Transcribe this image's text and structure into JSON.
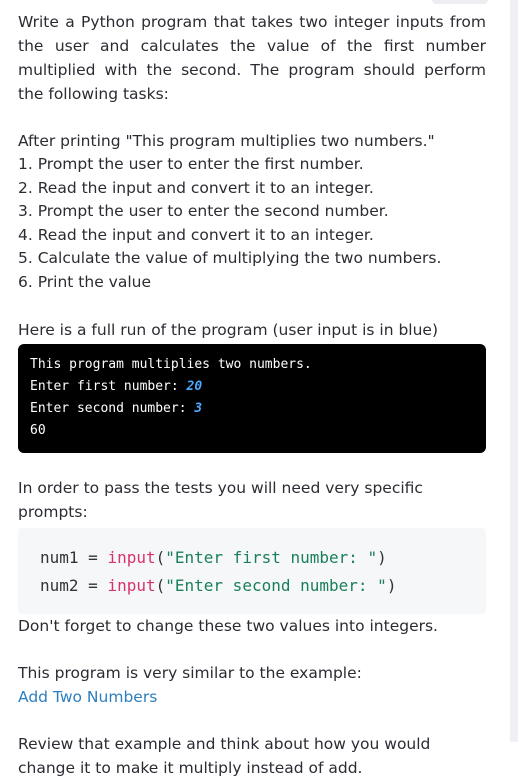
{
  "intro": "Write a Python program that takes two integer inputs from the user and calculates the value of the first number multiplied with the second. The program should perform the following tasks:",
  "after_printing": "After printing \"This program multiplies two numbers.\"",
  "steps": [
    "1. Prompt the user to enter the first number.",
    "2. Read the input and convert it to an integer.",
    "3. Prompt the user to enter the second number.",
    "4. Read the input and convert it to an integer.",
    "5. Calculate the value of multiplying the two numbers.",
    "6. Print the value"
  ],
  "full_run_text": "Here is a full run of the program (user input is in blue)",
  "terminal": {
    "line1": "This program multiplies two numbers.",
    "line2_prompt": "Enter first number: ",
    "line2_input": "20",
    "line3_prompt": "Enter second number: ",
    "line3_input": "3",
    "line4": "60"
  },
  "tests_text": "In order to pass the tests you will need very specific prompts:",
  "code": {
    "line1_var": "num1 = ",
    "line1_func": "input",
    "line1_open": "(",
    "line1_str": "\"Enter first number: \"",
    "line1_close": ")",
    "line2_var": "num2 = ",
    "line2_func": "input",
    "line2_open": "(",
    "line2_str": "\"Enter second number: \"",
    "line2_close": ")"
  },
  "forget_text": "Don't forget to change these two values into integers.",
  "similar_text": "This program is very similar to the example:",
  "example_link": "Add Two Numbers",
  "review_text": "Review that example and think about how you would change it to make it multiply instead of add.",
  "colors": {
    "user_input": "#4aa8ff",
    "keyword": "#d6336c",
    "string": "#1a7f5a",
    "link": "#2d7fbf"
  }
}
